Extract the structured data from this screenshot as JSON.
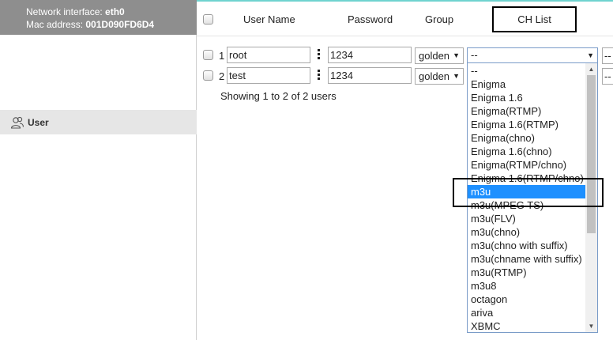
{
  "sidebar": {
    "network_label": "Network interface:",
    "network_value": "eth0",
    "mac_label": "Mac address:",
    "mac_value": "001D090FD6D4",
    "nav_user_label": "User",
    "nav_user_icon": "users-icon"
  },
  "table": {
    "headers": {
      "user_name": "User Name",
      "password": "Password",
      "group": "Group",
      "ch_list": "CH List"
    },
    "rows": [
      {
        "num": "1",
        "user": "root",
        "password": "1234",
        "group": "golden",
        "ch_list": "--",
        "extra": "--"
      },
      {
        "num": "2",
        "user": "test",
        "password": "1234",
        "group": "golden",
        "ch_list": "",
        "extra": "--"
      }
    ],
    "footer": "Showing 1 to 2 of 2 users"
  },
  "ch_dropdown": {
    "options": [
      "--",
      "Enigma",
      "Enigma 1.6",
      "Enigma(RTMP)",
      "Enigma 1.6(RTMP)",
      "Enigma(chno)",
      "Enigma 1.6(chno)",
      "Enigma(RTMP/chno)",
      "Enigma 1.6(RTMP/chno)",
      "m3u",
      "m3u(MPEG TS)",
      "m3u(FLV)",
      "m3u(chno)",
      "m3u(chno with suffix)",
      "m3u(chname with suffix)",
      "m3u(RTMP)",
      "m3u8",
      "octagon",
      "ariva",
      "XBMC"
    ],
    "selected": "m3u",
    "highlight_color": "#1e90ff"
  },
  "colors": {
    "sidebar_header_bg": "#8e8e8e",
    "active_nav_bg": "#e6e6e6",
    "accent_line": "#6fd3cf"
  }
}
